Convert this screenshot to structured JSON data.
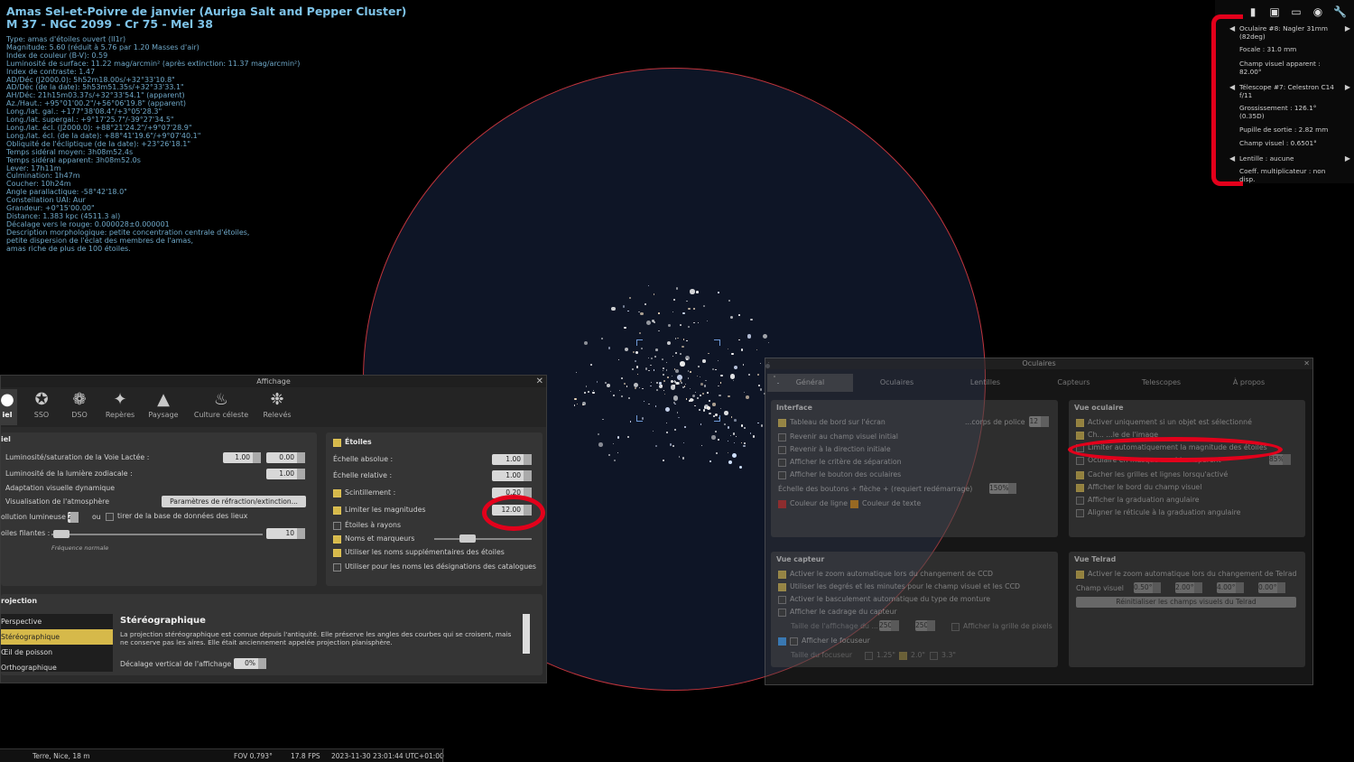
{
  "object_info": {
    "title_line1": "Amas Sel-et-Poivre de janvier (Auriga Salt and Pepper Cluster)",
    "title_line2": "M 37 - NGC 2099 - Cr 75 - Mel 38",
    "lines": [
      "Type: amas d'étoiles ouvert (II1r)",
      "Magnitude: 5.60 (réduit à 5.76 par 1.20 Masses d'air)",
      "Index de couleur (B-V): 0.59",
      "Luminosité de surface: 11.22 mag/arcmin² (après extinction: 11.37 mag/arcmin²)",
      "Index de contraste: 1.47",
      "AD/Déc (J2000.0): 5h52m18.00s/+32°33'10.8\"",
      "AD/Déc (de la date): 5h53m51.35s/+32°33'33.1\"",
      "AH/Déc: 21h15m03.37s/+32°33'54.1\" (apparent)",
      "Az./Haut.: +95°01'00.2\"/+56°06'19.8\" (apparent)",
      "Long./lat. gal.: +177°38'08.4\"/+3°05'28.3\"",
      "Long./lat. supergal.: +9°17'25.7\"/-39°27'34.5\"",
      "Long./lat. écl. (J2000.0): +88°21'24.2\"/+9°07'28.9\"",
      "Long./lat. écl. (de la date): +88°41'19.6\"/+9°07'40.1\"",
      "Obliquité de l'écliptique (de la date): +23°26'18.1\"",
      "Temps sidéral moyen: 3h08m52.4s",
      "Temps sidéral apparent: 3h08m52.0s",
      "Lever: 17h11m",
      "Culmination: 1h47m",
      "Coucher: 10h24m",
      "Angle parallactique: -58°42'18.0\"",
      "Constellation UAI: Aur",
      "Grandeur: +0°15'00.00\"",
      "Distance: 1.383 kpc (4511.3 al)",
      "Décalage vers le rouge: 0.000028±0.000001",
      "Description morphologique: petite concentration centrale d'étoiles,",
      "petite dispersion de l'éclat des membres de l'amas,",
      "amas riche de plus de 100 étoiles."
    ]
  },
  "ocular_hud": {
    "icons": [
      "ocular-icon",
      "ccd-icon",
      "telrad-icon",
      "lens-icon",
      "wrench-icon"
    ],
    "ocular": "Oculaire #8: Nagler 31mm (82deg)",
    "focal": "Focale : 31.0 mm",
    "apparent_fov": "Champ visuel apparent : 82.00°",
    "telescope": "Télescope #7: Celestron C14 f/11",
    "magnification": "Grossissement : 126.1° (0.35D)",
    "exit_pupil": "Pupille de sortie : 2.82 mm",
    "fov": "Champ visuel : 0.6501°",
    "lens": "Lentille : aucune",
    "multiplier": "Coeff. multiplicateur : non disp."
  },
  "affichage": {
    "title": "Affichage",
    "tabs": [
      "iel",
      "SSO",
      "DSO",
      "Repères",
      "Paysage",
      "Culture céleste",
      "Relevés"
    ],
    "sky_group": {
      "header": "iel",
      "milky_way": "Luminosité/saturation de la Voie Lactée :",
      "mw_val1": "1.00",
      "mw_val2": "0.00",
      "zodiacal": "Luminosité de la lumière zodiacale :",
      "zodiacal_val": "1.00",
      "adaptation": "Adaptation visuelle dynamique",
      "atmosphere": "Visualisation de l'atmosphère",
      "refraction_btn": "Paramètres de réfraction/extinction...",
      "light_pollution": "ollution lumineuse :",
      "lp_val": "2",
      "or": "ou",
      "lp_db": "tirer de la base de données des lieux",
      "meteors": "oiles filantes :",
      "meteor_val": "10",
      "meteor_note": "Fréquence normale"
    },
    "stars_group": {
      "header": "Étoiles",
      "absolute": "Échelle absolue :",
      "absolute_val": "1.00",
      "relative": "Échelle relative :",
      "relative_val": "1.00",
      "twinkle": "Scintillement :",
      "twinkle_val": "0.20",
      "limit_mag": "Limiter les magnitudes",
      "limit_mag_val": "12.00",
      "spiky": "Étoiles à rayons",
      "names": "Noms et marqueurs",
      "extra_names": "Utiliser les noms supplémentaires des étoiles",
      "catalog_names": "Utiliser pour les noms les désignations des catalogues"
    },
    "projection": {
      "header": "rojection",
      "items": [
        "Perspective",
        "Stéréographique",
        "Œil de poisson",
        "Orthographique"
      ],
      "selected_title": "Stéréographique",
      "desc": "La projection stéréographique est connue depuis l'antiquité. Elle préserve les angles des courbes qui se croisent, mais ne conserve pas les aires. Elle était anciennement appelée projection planisphère.",
      "offset_label": "Décalage vertical de l'affichage",
      "offset_val": "0%"
    }
  },
  "oculaires": {
    "title": "Oculaires",
    "tabs": [
      "Général",
      "Oculaires",
      "Lentilles",
      "Capteurs",
      "Telescopes",
      "À propos"
    ],
    "interface": {
      "header": "Interface",
      "dashboard": "Tableau de bord sur l'écran",
      "font_label": "...corps de police",
      "font_val": "12",
      "revert": "Revenir au champ visuel initial",
      "revert_dir": "Revenir à la direction initiale",
      "separation": "Afficher le critère de séparation",
      "button": "Afficher le bouton des oculaires",
      "scale": "Échelle des boutons + flèche + (requiert redémarrage)",
      "scale_val": "150%",
      "line_color": "Couleur de ligne",
      "text_color": "Couleur de texte"
    },
    "ocular_view": {
      "header": "Vue oculaire",
      "only_selected": "Activer uniquement si un objet est sélectionné",
      "center": "Ch... ...le de l'image",
      "auto_limit": "Limiter automatiquement la magnitude des étoiles",
      "semi_transparent": "Oculaire en masque semi-transparent",
      "st_val": "85%",
      "hide_grids": "Cacher les grilles et lignes lorsqu'activé",
      "show_edge": "Afficher le bord du champ visuel",
      "angular": "Afficher la graduation angulaire",
      "align": "Aligner le réticule à la graduation angulaire"
    },
    "sensor_view": {
      "header": "Vue capteur",
      "auto_zoom_ccd": "Activer le zoom automatique lors du changement de CCD",
      "deg_min": "Utiliser les degrés et les minutes pour le champ visuel et les CCD",
      "mount": "Activer le basculement automatique du type de monture",
      "frame": "Afficher le cadrage du capteur",
      "size": "Taille de l'affichage du ...",
      "size_val1": "250",
      "size_val2": "250",
      "pixel_grid": "Afficher la grille de pixels",
      "focuser": "Afficher le focuseur",
      "focuser_size": "Taille du focuseur",
      "f1": "1.25\"",
      "f2": "2.0\"",
      "f3": "3.3\""
    },
    "telrad": {
      "header": "Vue Telrad",
      "auto_zoom": "Activer le zoom automatique lors du changement de Telrad",
      "fov_label": "Champ visuel",
      "v1": "0.50°",
      "v2": "2.00°",
      "v3": "4.00°",
      "v4": "0.00°",
      "reset_btn": "Réinitialiser les champs visuels du Telrad"
    }
  },
  "status_bar": {
    "location": "Terre, Nice, 18 m",
    "fov": "FOV 0.793°",
    "fps": "17.8 FPS",
    "datetime": "2023-11-30 23:01:44 UTC+01:00"
  },
  "colors": {
    "annotation_red": "#e3001b",
    "info_text": "#6fa8c8",
    "fov_circle": "#c0343c",
    "checkbox_on": "#d6b94a"
  }
}
